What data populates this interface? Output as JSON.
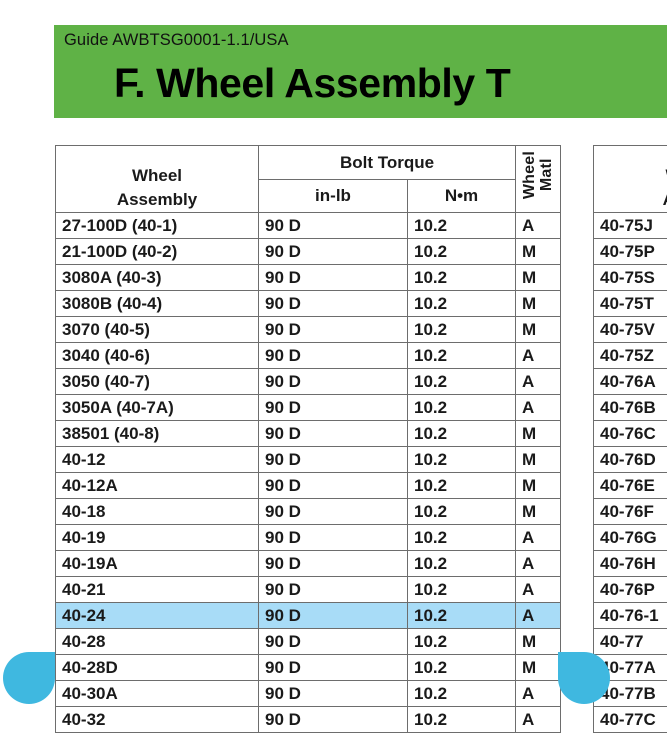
{
  "document": {
    "banner": {
      "guide_label": "Guide AWBTSG0001-1.1/USA",
      "title": "F.  Wheel Assembly T",
      "background_color": "#5fb246"
    }
  },
  "selection": {
    "highlight_color": "#a8dcf7",
    "handle_color": "#3fb8e0",
    "selected_row_label": "40-24",
    "left_handle_name": "selection-handle-left",
    "right_handle_name": "selection-handle-right"
  },
  "table_left": {
    "headers": {
      "wheel_assembly": "Wheel\nAssembly",
      "wheel_assembly_line1": "Wheel",
      "wheel_assembly_line2": "Assembly",
      "bolt_torque": "Bolt Torque",
      "in_lb": "in-lb",
      "n_m": "N•m",
      "wheel_matl_line1": "Wheel",
      "wheel_matl_line2": "Matl"
    },
    "rows": [
      {
        "assembly": "27-100D (40-1)",
        "in_lb": "90 D",
        "n_m": "10.2",
        "matl": "A",
        "selected": false
      },
      {
        "assembly": "21-100D (40-2)",
        "in_lb": "90 D",
        "n_m": "10.2",
        "matl": "M",
        "selected": false
      },
      {
        "assembly": "3080A (40-3)",
        "in_lb": "90 D",
        "n_m": "10.2",
        "matl": "M",
        "selected": false
      },
      {
        "assembly": "3080B (40-4)",
        "in_lb": "90 D",
        "n_m": "10.2",
        "matl": "M",
        "selected": false
      },
      {
        "assembly": "3070 (40-5)",
        "in_lb": "90 D",
        "n_m": "10.2",
        "matl": "M",
        "selected": false
      },
      {
        "assembly": "3040 (40-6)",
        "in_lb": "90 D",
        "n_m": "10.2",
        "matl": "A",
        "selected": false
      },
      {
        "assembly": "3050 (40-7)",
        "in_lb": "90 D",
        "n_m": "10.2",
        "matl": "A",
        "selected": false
      },
      {
        "assembly": "3050A (40-7A)",
        "in_lb": "90 D",
        "n_m": "10.2",
        "matl": "A",
        "selected": false
      },
      {
        "assembly": "38501 (40-8)",
        "in_lb": "90 D",
        "n_m": "10.2",
        "matl": "M",
        "selected": false
      },
      {
        "assembly": "40-12",
        "in_lb": "90 D",
        "n_m": "10.2",
        "matl": "M",
        "selected": false
      },
      {
        "assembly": "40-12A",
        "in_lb": "90 D",
        "n_m": "10.2",
        "matl": "M",
        "selected": false
      },
      {
        "assembly": "40-18",
        "in_lb": "90 D",
        "n_m": "10.2",
        "matl": "M",
        "selected": false
      },
      {
        "assembly": "40-19",
        "in_lb": "90 D",
        "n_m": "10.2",
        "matl": "A",
        "selected": false
      },
      {
        "assembly": "40-19A",
        "in_lb": "90 D",
        "n_m": "10.2",
        "matl": "A",
        "selected": false
      },
      {
        "assembly": "40-21",
        "in_lb": "90 D",
        "n_m": "10.2",
        "matl": "A",
        "selected": false
      },
      {
        "assembly": "40-24",
        "in_lb": "90 D",
        "n_m": "10.2",
        "matl": "A",
        "selected": true
      },
      {
        "assembly": "40-28",
        "in_lb": "90 D",
        "n_m": "10.2",
        "matl": "M",
        "selected": false
      },
      {
        "assembly": "40-28D",
        "in_lb": "90 D",
        "n_m": "10.2",
        "matl": "M",
        "selected": false
      },
      {
        "assembly": "40-30A",
        "in_lb": "90 D",
        "n_m": "10.2",
        "matl": "A",
        "selected": false
      },
      {
        "assembly": "40-32",
        "in_lb": "90 D",
        "n_m": "10.2",
        "matl": "A",
        "selected": false
      }
    ]
  },
  "table_right": {
    "headers": {
      "wheel_assembly_line1": "W",
      "wheel_assembly_line2": "As"
    },
    "rows": [
      {
        "assembly": "40-75J"
      },
      {
        "assembly": "40-75P"
      },
      {
        "assembly": "40-75S"
      },
      {
        "assembly": "40-75T"
      },
      {
        "assembly": "40-75V"
      },
      {
        "assembly": "40-75Z"
      },
      {
        "assembly": "40-76A"
      },
      {
        "assembly": "40-76B"
      },
      {
        "assembly": "40-76C"
      },
      {
        "assembly": "40-76D"
      },
      {
        "assembly": "40-76E"
      },
      {
        "assembly": "40-76F"
      },
      {
        "assembly": "40-76G"
      },
      {
        "assembly": "40-76H"
      },
      {
        "assembly": "40-76P"
      },
      {
        "assembly": "40-76-1"
      },
      {
        "assembly": "40-77"
      },
      {
        "assembly": "40-77A"
      },
      {
        "assembly": "40-77B"
      },
      {
        "assembly": "40-77C"
      }
    ]
  }
}
